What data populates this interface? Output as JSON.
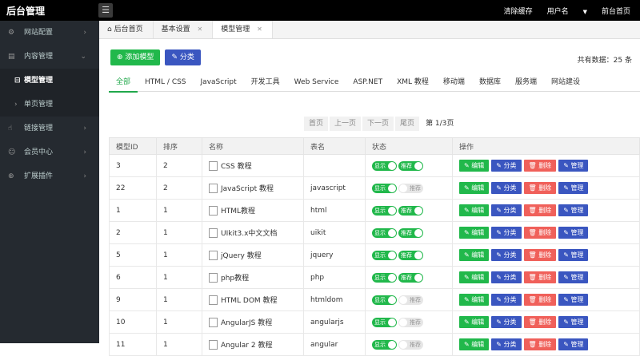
{
  "topbar": {
    "title": "后台管理",
    "menu_icon": "hamburger-icon",
    "links": [
      "清除缓存",
      "用户名",
      "前台首页"
    ]
  },
  "sidebar": {
    "items": [
      {
        "label": "网站配置",
        "icon": "gear-icon",
        "has_arrow": true
      },
      {
        "label": "内容管理",
        "icon": "list-icon",
        "has_arrow": true,
        "expanded": true
      },
      {
        "label": "模型管理",
        "icon": "model-icon",
        "active": true
      },
      {
        "label": "单页管理",
        "icon": "chevron-right-icon",
        "sub": true
      },
      {
        "label": "链接管理",
        "icon": "thumb-icon",
        "has_arrow": true
      },
      {
        "label": "会员中心",
        "icon": "user-icon",
        "has_arrow": true
      },
      {
        "label": "扩展插件",
        "icon": "plugin-icon",
        "has_arrow": true
      }
    ]
  },
  "tabs": [
    {
      "label": "后台首页",
      "icon": "home-icon"
    },
    {
      "label": "基本设置",
      "closable": true
    },
    {
      "label": "模型管理",
      "closable": true,
      "active": true
    }
  ],
  "toolbar": {
    "add_label": "添加模型",
    "category_label": "分类",
    "total_label": "共有数据：25 条"
  },
  "categories": [
    "全部",
    "HTML / CSS",
    "JavaScript",
    "开发工具",
    "Web Service",
    "ASP.NET",
    "XML 教程",
    "移动端",
    "数据库",
    "服务端",
    "网站建设"
  ],
  "pager": {
    "first": "首页",
    "prev": "上一页",
    "next": "下一页",
    "last": "尾页",
    "info": "第 1/3页"
  },
  "table": {
    "headers": [
      "模型ID",
      "排序",
      "名称",
      "表名",
      "状态",
      "操作"
    ],
    "toggle_show": "显示",
    "toggle_recommend": "推荐",
    "actions": [
      "编辑",
      "分类",
      "删除",
      "管理"
    ],
    "rows": [
      {
        "id": "3",
        "sort": "2",
        "name": "CSS 教程",
        "table": "",
        "show": true,
        "rec": true
      },
      {
        "id": "22",
        "sort": "2",
        "name": "JavaScript 教程",
        "table": "javascript",
        "show": true,
        "rec": false
      },
      {
        "id": "1",
        "sort": "1",
        "name": "HTML教程",
        "table": "html",
        "show": true,
        "rec": true
      },
      {
        "id": "2",
        "sort": "1",
        "name": "UIkit3.x中文文档",
        "table": "uikit",
        "show": true,
        "rec": true
      },
      {
        "id": "5",
        "sort": "1",
        "name": "jQuery 教程",
        "table": "jquery",
        "show": true,
        "rec": true
      },
      {
        "id": "6",
        "sort": "1",
        "name": "php教程",
        "table": "php",
        "show": true,
        "rec": true
      },
      {
        "id": "9",
        "sort": "1",
        "name": "HTML DOM 教程",
        "table": "htmldom",
        "show": true,
        "rec": false
      },
      {
        "id": "10",
        "sort": "1",
        "name": "AngularJS 教程",
        "table": "angularjs",
        "show": true,
        "rec": false
      },
      {
        "id": "11",
        "sort": "1",
        "name": "Angular 2 教程",
        "table": "angular",
        "show": true,
        "rec": false
      }
    ]
  }
}
